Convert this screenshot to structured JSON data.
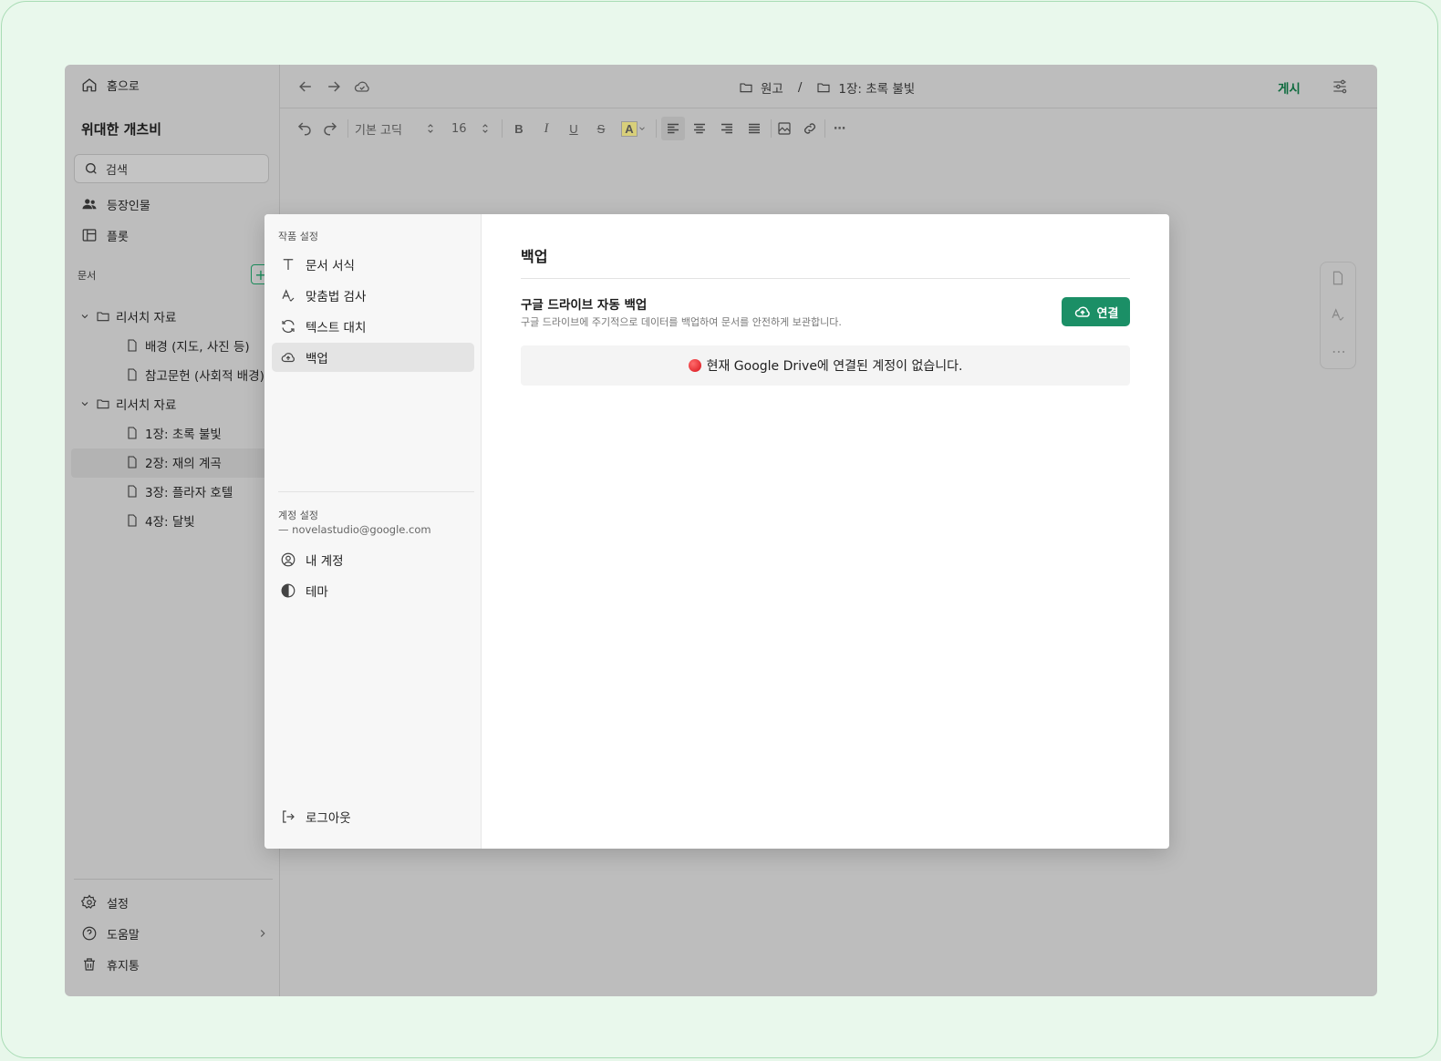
{
  "sidebar": {
    "home": "홈으로",
    "project_title": "위대한 개츠비",
    "search_placeholder": "검색",
    "nav": [
      {
        "label": "등장인물",
        "icon": "people-icon"
      },
      {
        "label": "플롯",
        "icon": "layout-icon"
      }
    ],
    "section_label": "문서",
    "folders": [
      {
        "label": "리서치 자료",
        "items": [
          "배경 (지도, 사진 등)",
          "참고문헌 (사회적 배경)"
        ]
      },
      {
        "label": "리서치 자료",
        "items": [
          "1장: 초록 불빛",
          "2장: 재의 계곡",
          "3장: 플라자 호텔",
          "4장: 달빛"
        ]
      }
    ],
    "footer": [
      {
        "label": "설정",
        "icon": "gear-icon"
      },
      {
        "label": "도움말",
        "icon": "help-icon"
      },
      {
        "label": "휴지통",
        "icon": "trash-icon"
      }
    ]
  },
  "topbar": {
    "breadcrumb": [
      "원고",
      "1장: 초록 불빛"
    ],
    "separator": "/",
    "publish": "게시"
  },
  "toolbar": {
    "font": "기본 고딕",
    "size": "16"
  },
  "modal": {
    "work_settings": "작품 설정",
    "work_items": [
      {
        "label": "문서 서식",
        "icon": "text-icon"
      },
      {
        "label": "맞춤법 검사",
        "icon": "spellcheck-icon"
      },
      {
        "label": "텍스트 대치",
        "icon": "replace-icon"
      },
      {
        "label": "백업",
        "icon": "cloud-icon",
        "active": true
      }
    ],
    "account_settings": "계정 설정",
    "email": "— novelastudio@google.com",
    "account_items": [
      {
        "label": "내 계정",
        "icon": "user-circle-icon"
      },
      {
        "label": "테마",
        "icon": "theme-icon"
      }
    ],
    "logout": "로그아웃",
    "heading": "백업",
    "option_title": "구글 드라이브 자동 백업",
    "option_desc": "구글 드라이브에 주기적으로 데이터를 백업하여 문서를 안전하게 보관합니다.",
    "connect": "연결",
    "notice": "현재 Google Drive에 연결된 계정이 없습니다.",
    "accent": "#1b8f66"
  }
}
